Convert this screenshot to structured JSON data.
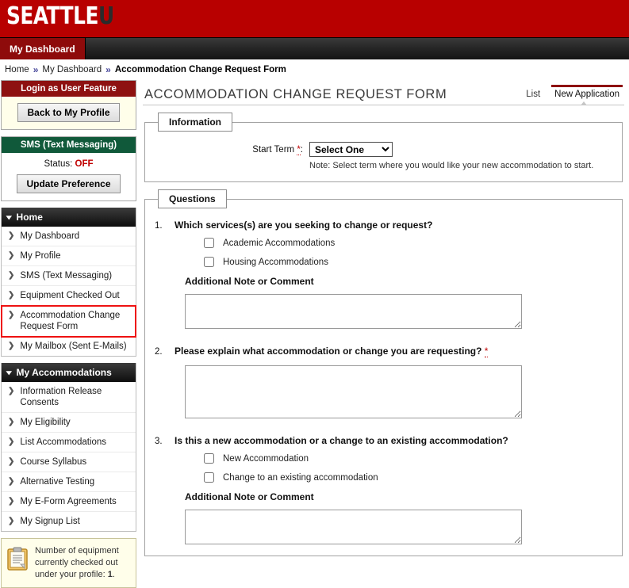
{
  "banner": {
    "logo_main": "SEATTLE",
    "logo_accent": "U"
  },
  "nav": {
    "tabs": [
      {
        "label": "My Dashboard",
        "active": true
      }
    ]
  },
  "breadcrumb": {
    "items": [
      "Home",
      "My Dashboard",
      "Accommodation Change Request Form"
    ],
    "separator": "»"
  },
  "sidebar": {
    "login_panel": {
      "title": "Login as User Feature",
      "button": "Back to My Profile"
    },
    "sms_panel": {
      "title": "SMS (Text Messaging)",
      "status_label": "Status:",
      "status_value": "OFF",
      "button": "Update Preference"
    },
    "menus": [
      {
        "title": "Home",
        "items": [
          {
            "label": "My Dashboard",
            "active": false
          },
          {
            "label": "My Profile",
            "active": false
          },
          {
            "label": "SMS (Text Messaging)",
            "active": false
          },
          {
            "label": "Equipment Checked Out",
            "active": false
          },
          {
            "label": "Accommodation Change Request Form",
            "active": true
          },
          {
            "label": "My Mailbox (Sent E-Mails)",
            "active": false
          }
        ]
      },
      {
        "title": "My Accommodations",
        "items": [
          {
            "label": "Information Release Consents",
            "active": false
          },
          {
            "label": "My Eligibility",
            "active": false
          },
          {
            "label": "List Accommodations",
            "active": false
          },
          {
            "label": "Course Syllabus",
            "active": false
          },
          {
            "label": "Alternative Testing",
            "active": false
          },
          {
            "label": "My E-Form Agreements",
            "active": false
          },
          {
            "label": "My Signup List",
            "active": false
          }
        ]
      }
    ],
    "equipment_note": {
      "text_before": "Number of equipment currently checked out under your profile: ",
      "count": "1",
      "text_after": "."
    }
  },
  "main": {
    "page_title": "Accommodation Change Request Form",
    "tabs": [
      {
        "label": "List",
        "active": false
      },
      {
        "label": "New Application",
        "active": true
      }
    ],
    "information": {
      "legend": "Information",
      "start_term_label": "Start Term",
      "required_mark": "*",
      "colon": ":",
      "select_value": "Select One",
      "select_options": [
        "Select One"
      ],
      "note": "Note: Select term where you would like your new accommodation to start."
    },
    "questions": {
      "legend": "Questions",
      "additional_note_label": "Additional Note or Comment",
      "items": [
        {
          "number": "1.",
          "text": "Which services(s) are you seeking to change or request?",
          "required": false,
          "options": [
            "Academic Accommodations",
            "Housing Accommodations"
          ],
          "has_note": true,
          "note_value": ""
        },
        {
          "number": "2.",
          "text": "Please explain what accommodation or change you are requesting?",
          "required": true,
          "options": [],
          "has_note": false,
          "answer_value": ""
        },
        {
          "number": "3.",
          "text": "Is this a new accommodation or a change to an existing accommodation?",
          "required": false,
          "options": [
            "New Accommodation",
            "Change to an existing accommodation"
          ],
          "has_note": true,
          "note_value": ""
        }
      ]
    }
  },
  "colors": {
    "banner_red": "#b80000",
    "tab_red": "#8e0b0b",
    "panel_red": "#8e1111",
    "panel_green": "#10593a",
    "highlight_red": "#ee1111",
    "status_red": "#c00000"
  }
}
